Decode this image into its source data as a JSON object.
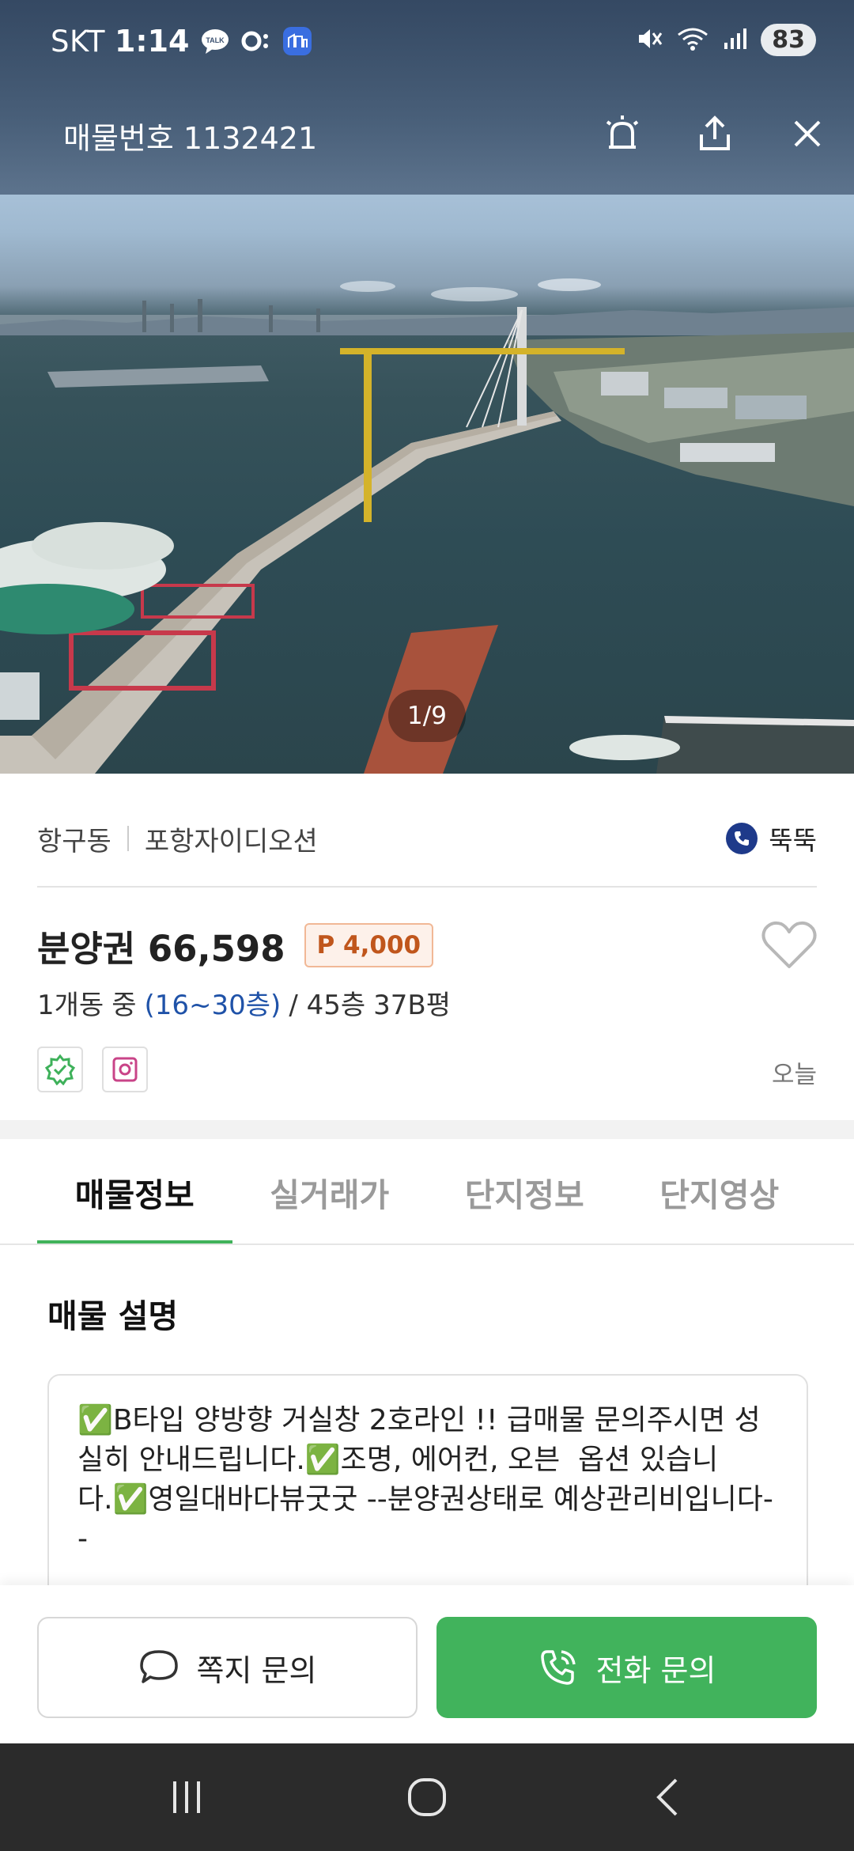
{
  "status_bar": {
    "carrier": "SKT",
    "time": "1:14",
    "battery": "83",
    "icons": [
      "talk-icon",
      "o-icon",
      "app-icon",
      "mute-icon",
      "wifi-icon",
      "signal-icon"
    ]
  },
  "app_bar": {
    "listing_number": "매물번호 1132421",
    "icons": [
      "alarm-icon",
      "share-icon",
      "close-icon"
    ]
  },
  "photo": {
    "counter": "1/9"
  },
  "location": {
    "dong": "항구동",
    "complex": "포항자이디오션",
    "agent_name": "뚝뚝"
  },
  "listing": {
    "price": "분양권 66,598",
    "premium": "P 4,000",
    "building": "1개동",
    "floor_prefix": "중",
    "floor_range": "(16~30층)",
    "total_floors": "/ 45층",
    "size": "37B평",
    "date": "오늘"
  },
  "tabs": [
    {
      "label": "매물정보",
      "active": true
    },
    {
      "label": "실거래가",
      "active": false
    },
    {
      "label": "단지정보",
      "active": false
    },
    {
      "label": "단지영상",
      "active": false
    }
  ],
  "description": {
    "title": "매물 설명",
    "text": "✅B타입 양방향 거실창 2호라인 !! 급매물 문의주시면 성실히 안내드립니다.✅조명, 에어컨, 오븐  옵션 있습니다.✅영일대바다뷰굿굿 --분양권상태로 예상관리비입니다--"
  },
  "actions": {
    "message_label": "쪽지 문의",
    "call_label": "전화 문의"
  },
  "colors": {
    "accent_green": "#41b35c",
    "premium_orange": "#c0561c",
    "floor_blue": "#1f52a8",
    "nav_dark": "#2b2b2b"
  }
}
